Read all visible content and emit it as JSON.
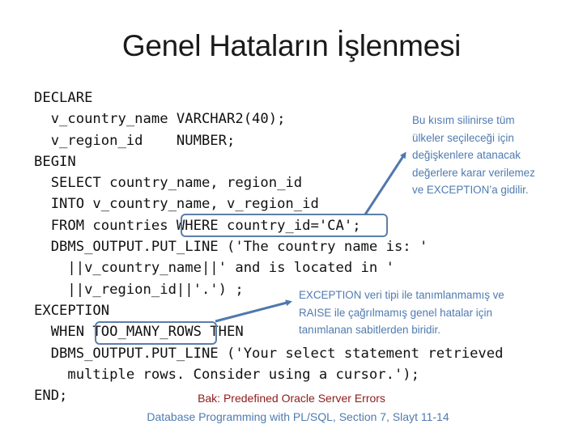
{
  "slide": {
    "title": "Genel Hataların İşlenmesi",
    "code_lines": [
      "DECLARE",
      "  v_country_name VARCHAR2(40);",
      "  v_region_id    NUMBER;",
      "BEGIN",
      "  SELECT country_name, region_id",
      "  INTO v_country_name, v_region_id",
      "  FROM countries WHERE country_id='CA';",
      "  DBMS_OUTPUT.PUT_LINE ('The country name is: '",
      "    ||v_country_name||' and is located in '",
      "    ||v_region_id||'.') ;",
      "EXCEPTION",
      "  WHEN TOO_MANY_ROWS THEN",
      "  DBMS_OUTPUT.PUT_LINE ('Your select statement retrieved",
      "    multiple rows. Consider using a cursor.');",
      "END;"
    ],
    "highlights": [
      {
        "text": "WHERE country_id='CA';",
        "note_ref": "note1"
      },
      {
        "text": "TOO_MANY_ROWS",
        "note_ref": "note2"
      }
    ],
    "note1": {
      "lines": [
        "Bu kısım silinirse tüm",
        "ülkeler seçileceği için",
        "değişkenlere atanacak",
        "değerlere karar verilemez",
        "ve EXCEPTION’a gidilir."
      ]
    },
    "note2": {
      "lines": [
        "EXCEPTION veri tipi ile tanımlanmamış ve",
        "RAISE ile çağrılmamış genel hatalar için",
        "tanımlanan sabitlerden biridir."
      ]
    },
    "reference": {
      "line1": "Bak: Predefined Oracle Server Errors",
      "line2": "Database Programming with PL/SQL, Section 7, Slayt 11-14"
    },
    "colors": {
      "note_blue": "#4f7bb0",
      "box_blue": "#5a7fa9",
      "reference_red": "#8e1b1b"
    }
  }
}
